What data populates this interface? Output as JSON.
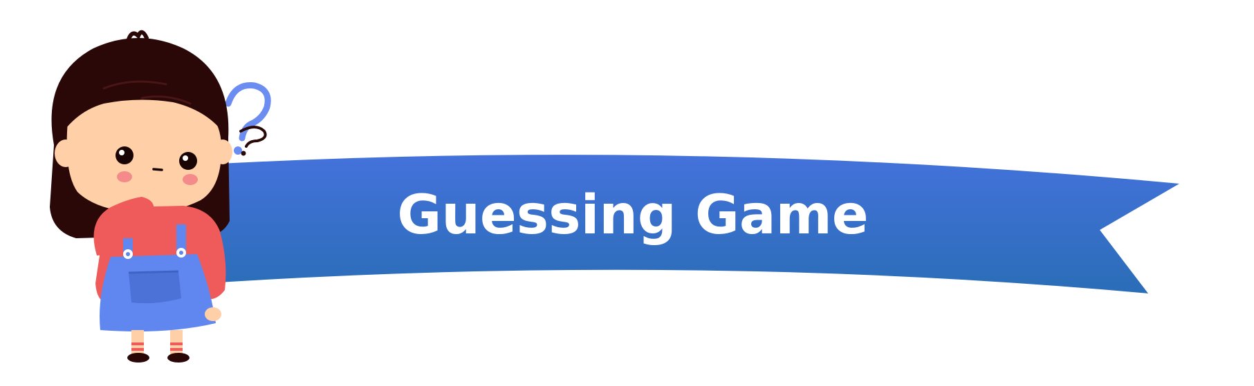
{
  "banner": {
    "title": "Guessing Game"
  },
  "colors": {
    "banner_top": "#4472DB",
    "banner_bottom": "#2A6DB7",
    "question_mark": "#6B8CF0",
    "hair": "#2A0808",
    "skin": "#FFCFA8",
    "cheek": "#F58A8A",
    "sweater": "#EF5B5B",
    "overalls": "#5F87EF",
    "background": "#FFFFFF"
  },
  "icons": {
    "character": "thinking-girl-icon",
    "question": "question-mark-icon"
  }
}
